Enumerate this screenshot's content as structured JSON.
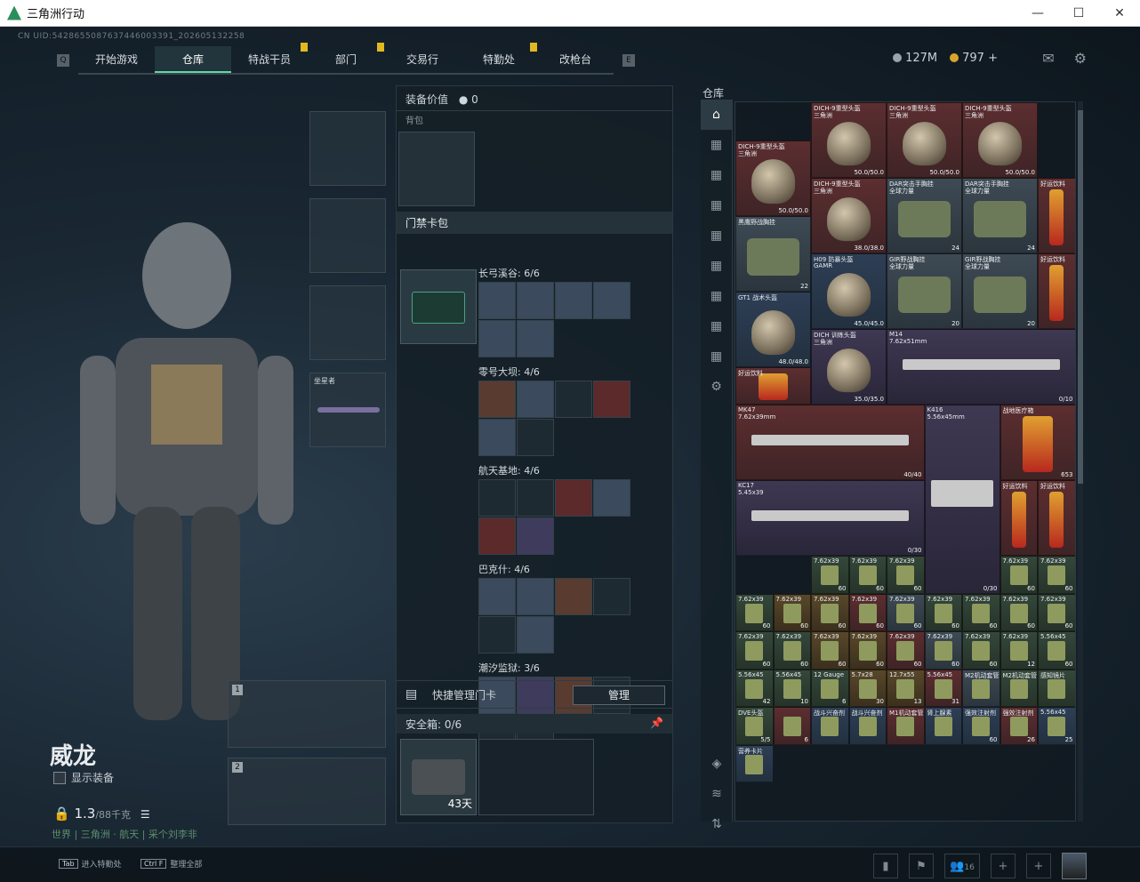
{
  "window": {
    "title": "三角洲行动",
    "minimize": "—",
    "maximize": "☐",
    "close": "✕"
  },
  "uid": "CN UID:5428655087637446003391_202605132258",
  "nav": {
    "tabs": [
      {
        "label": "开始游戏",
        "active": false,
        "badge": false
      },
      {
        "label": "仓库",
        "active": true,
        "badge": false
      },
      {
        "label": "特战干员",
        "active": false,
        "badge": true
      },
      {
        "label": "部门",
        "active": false,
        "badge": true
      },
      {
        "label": "交易行",
        "active": false,
        "badge": false
      },
      {
        "label": "特勤处",
        "active": false,
        "badge": true
      },
      {
        "label": "改枪台",
        "active": false,
        "badge": false
      }
    ],
    "left_key": "Q",
    "right_key": "E"
  },
  "currency": {
    "silver": "127M",
    "gold": "797",
    "plus": "+"
  },
  "character": {
    "name": "威龙",
    "show_equip": "显示装备",
    "weight": "1.3",
    "weight_max": "/88千克",
    "map_line": "世界 | 三角洲 · 航天 | 采个刘李非"
  },
  "equipment": {
    "melee_label": "坐星者",
    "gun1": "1",
    "gun2": "2"
  },
  "middle": {
    "value_label": "装备价值",
    "value": "0",
    "backpack_label": "背包",
    "keycase_title": "门禁卡包",
    "groups": [
      {
        "name": "长弓溪谷: 6/6"
      },
      {
        "name": "零号大坝: 4/6"
      },
      {
        "name": "航天基地: 4/6"
      },
      {
        "name": "巴克什: 4/6"
      },
      {
        "name": "潮汐监狱: 3/6"
      }
    ],
    "quick_manage": "快捷管理门卡",
    "manage_btn": "管理",
    "safe_label": "安全箱:",
    "safe_count": "0/6",
    "safe_days": "43天"
  },
  "warehouse": {
    "title": "仓库",
    "items": [
      {
        "name": "DICH-9重型头盔",
        "sub": "三角洲",
        "count": "50.0/50.0",
        "color": "red"
      },
      {
        "name": "DICH-9重型头盔",
        "sub": "三角洲",
        "count": "50.0/50.0",
        "color": "red"
      },
      {
        "name": "DICH-9重型头盔",
        "sub": "三角洲",
        "count": "50.0/50.0",
        "color": "red"
      },
      {
        "name": "DICH-9重型头盔",
        "sub": "三角洲",
        "count": "50.0/50.0",
        "color": "red"
      },
      {
        "name": "DICH-9重型头盔",
        "sub": "三角洲",
        "count": "38.0/38.0",
        "color": "red"
      },
      {
        "name": "DAR突击手胸挂",
        "sub": "全球力量",
        "count": "24",
        "color": "gray"
      },
      {
        "name": "DAR突击手胸挂",
        "sub": "全球力量",
        "count": "24",
        "color": "gray"
      },
      {
        "name": "好运饮料",
        "sub": "",
        "count": "",
        "color": "red"
      },
      {
        "name": "黑鹰野战胸挂",
        "sub": "",
        "count": "22",
        "color": "gray"
      },
      {
        "name": "H09 防暴头盔",
        "sub": "GAMR",
        "count": "45.0/45.0",
        "color": "blue"
      },
      {
        "name": "GIR野战胸挂",
        "sub": "全球力量",
        "count": "20",
        "color": "gray"
      },
      {
        "name": "GIR野战胸挂",
        "sub": "全球力量",
        "count": "20",
        "color": "gray"
      },
      {
        "name": "好运饮料",
        "sub": "",
        "count": "",
        "color": "red"
      },
      {
        "name": "GT1 战术头盔",
        "sub": "",
        "count": "48.0/48.0",
        "color": "blue"
      },
      {
        "name": "M14",
        "sub": "7.62x51mm",
        "count": "0/10",
        "color": "purple"
      },
      {
        "name": "DICH 训练头盔",
        "sub": "三角洲",
        "count": "35.0/35.0",
        "color": "purple"
      },
      {
        "name": "好运饮料",
        "sub": "",
        "count": "",
        "color": "red"
      },
      {
        "name": "MK47",
        "sub": "7.62x39mm",
        "count": "40/40",
        "color": "red"
      },
      {
        "name": "K416",
        "sub": "5.56x45mm",
        "count": "0/30",
        "color": "purple"
      },
      {
        "name": "战地医疗箱",
        "sub": "",
        "count": "653",
        "color": "red"
      },
      {
        "name": "KC17",
        "sub": "5.45x39",
        "count": "0/30",
        "color": "purple"
      },
      {
        "name": "好运饮料",
        "sub": "",
        "count": "",
        "color": "red"
      },
      {
        "name": "好运饮料",
        "sub": "",
        "count": "",
        "color": "red"
      }
    ],
    "ammo": [
      {
        "name": "7.62x39",
        "count": "60"
      },
      {
        "name": "7.62x39",
        "count": "60"
      },
      {
        "name": "7.62x39",
        "count": "60"
      },
      {
        "name": "7.62x39",
        "count": "60"
      },
      {
        "name": "7.62x39",
        "count": "60"
      },
      {
        "name": "7.62x39",
        "count": "60"
      },
      {
        "name": "7.62x39",
        "count": "60"
      },
      {
        "name": "7.62x39",
        "count": "60"
      },
      {
        "name": "7.62x39",
        "count": "60"
      },
      {
        "name": "7.62x39",
        "count": "60"
      },
      {
        "name": "7.62x39",
        "count": "60"
      },
      {
        "name": "7.62x39",
        "count": "60"
      },
      {
        "name": "7.62x39",
        "count": "60"
      },
      {
        "name": "7.62x39",
        "count": "60"
      },
      {
        "name": "7.62x39",
        "count": "60"
      },
      {
        "name": "7.62x39",
        "count": "60"
      },
      {
        "name": "7.62x39",
        "count": "60"
      },
      {
        "name": "7.62x39",
        "count": "60"
      },
      {
        "name": "7.62x39",
        "count": "60"
      },
      {
        "name": "7.62x39",
        "count": "60"
      },
      {
        "name": "7.62x39",
        "count": "60"
      },
      {
        "name": "7.62x39",
        "count": "12"
      },
      {
        "name": "5.56x45",
        "count": "60"
      },
      {
        "name": "5.56x45",
        "count": "42"
      },
      {
        "name": "5.56x45",
        "count": "10"
      },
      {
        "name": "12 Gauge",
        "count": "6"
      },
      {
        "name": "5.7x28",
        "count": "30"
      },
      {
        "name": "12.7x55",
        "count": "13"
      },
      {
        "name": "5.56x45",
        "count": "31"
      },
      {
        "name": "M2机动套管",
        "count": ""
      },
      {
        "name": "M2机动套管",
        "count": ""
      },
      {
        "name": "感知镜片",
        "count": ""
      },
      {
        "name": "DVE头盔",
        "count": "5/5"
      },
      {
        "name": "",
        "count": "6"
      },
      {
        "name": "战斗兴奋剂",
        "count": ""
      },
      {
        "name": "战斗兴奋剂",
        "count": ""
      },
      {
        "name": "M1机动套管",
        "count": ""
      },
      {
        "name": "肾上腺素",
        "count": ""
      },
      {
        "name": "强效注射剂",
        "count": "60"
      },
      {
        "name": "强效注射剂",
        "count": "26"
      },
      {
        "name": "5.56x45",
        "count": "25"
      },
      {
        "name": "营养卡片",
        "count": ""
      }
    ]
  },
  "footer": {
    "hint1_key": "Tab",
    "hint1": "进入特勤处",
    "hint2_key": "Ctrl F",
    "hint2": "整理全部",
    "friends": "16"
  }
}
